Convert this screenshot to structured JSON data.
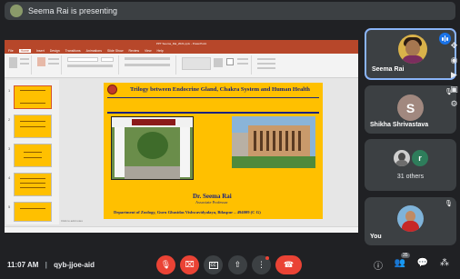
{
  "banner": {
    "text": "Seema Rai is presenting"
  },
  "presentation": {
    "window_title": "PPT Seema_Rai_2021.pptx - PowerPoint",
    "tabs": [
      "File",
      "Home",
      "Insert",
      "Design",
      "Transitions",
      "Animations",
      "Slide Show",
      "Review",
      "View",
      "Help"
    ],
    "active_tab": "Home",
    "slide": {
      "title": "Trilogy between Endocrine Gland, Chakra System and Human Health",
      "presenter": "Dr. Seema Rai",
      "designation": "Associate Professor",
      "department": "Department of  Zoology, Guru Ghasidas Vishwavidyalaya, Bilaspur – 494009 (C G)"
    },
    "notes_hint": "Click to add notes",
    "thumbnail_numbers": [
      "1",
      "2",
      "3",
      "4",
      "5"
    ]
  },
  "participants": [
    {
      "name": "Seema Rai",
      "speaking": true
    },
    {
      "name": "Shikha Shrivastava",
      "initial": "S",
      "muted": true
    },
    {
      "others_label": "31 others",
      "initial": "r"
    },
    {
      "name": "You",
      "muted": true
    }
  ],
  "meeting": {
    "time": "11:07 AM",
    "separator": "|",
    "code": "qyb-jjoe-aid",
    "participant_count": "35"
  },
  "colors": {
    "bg": "#202124",
    "tile": "#3c4043",
    "accent": "#8ab4f8",
    "danger": "#ea4335",
    "ppt": "#b7472a",
    "slide_bg": "#ffc000"
  },
  "icons": [
    "mic-off-icon",
    "camera-off-icon",
    "captions-icon",
    "present-icon",
    "more-icon",
    "end-call-icon",
    "info-icon",
    "people-icon",
    "chat-icon",
    "activities-icon"
  ]
}
